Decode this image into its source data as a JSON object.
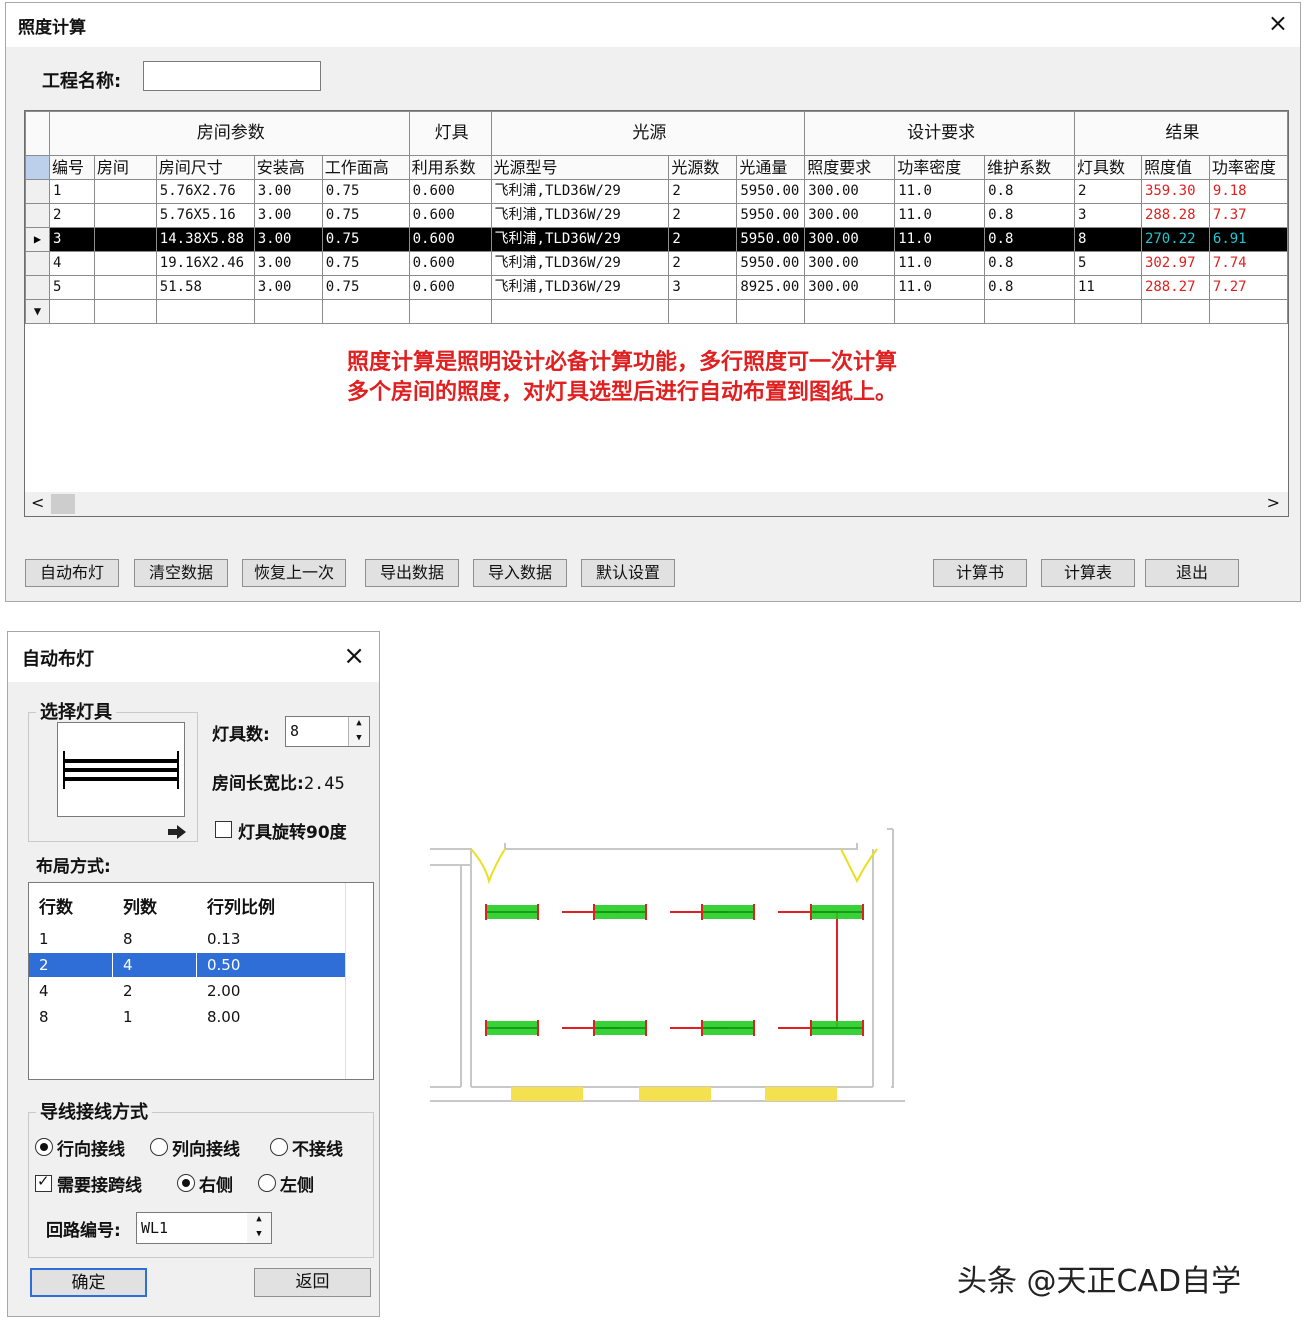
{
  "main_dialog": {
    "title": "照度计算",
    "close_icon": "×",
    "project_label": "工程名称:",
    "project_value": ""
  },
  "grid": {
    "groups": [
      "房间参数",
      "灯具",
      "光源",
      "设计要求",
      "结果"
    ],
    "columns": [
      "编号",
      "房间",
      "房间尺寸",
      "安装高",
      "工作面高",
      "利用系数",
      "光源型号",
      "光源数",
      "光通量",
      "照度要求",
      "功率密度",
      "维护系数",
      "灯具数",
      "照度值",
      "功率密度"
    ],
    "rows": [
      [
        "1",
        "",
        "5.76X2.76",
        "3.00",
        "0.75",
        "0.600",
        "飞利浦,TLD36W/29",
        "2",
        "5950.00",
        "300.00",
        "11.0",
        "0.8",
        "2",
        "359.30",
        "9.18"
      ],
      [
        "2",
        "",
        "5.76X5.16",
        "3.00",
        "0.75",
        "0.600",
        "飞利浦,TLD36W/29",
        "2",
        "5950.00",
        "300.00",
        "11.0",
        "0.8",
        "3",
        "288.28",
        "7.37"
      ],
      [
        "3",
        "",
        "14.38X5.88",
        "3.00",
        "0.75",
        "0.600",
        "飞利浦,TLD36W/29",
        "2",
        "5950.00",
        "300.00",
        "11.0",
        "0.8",
        "8",
        "270.22",
        "6.91"
      ],
      [
        "4",
        "",
        "19.16X2.46",
        "3.00",
        "0.75",
        "0.600",
        "飞利浦,TLD36W/29",
        "2",
        "5950.00",
        "300.00",
        "11.0",
        "0.8",
        "5",
        "302.97",
        "7.74"
      ],
      [
        "5",
        "",
        "51.58",
        "3.00",
        "0.75",
        "0.600",
        "飞利浦,TLD36W/29",
        "3",
        "8925.00",
        "300.00",
        "11.0",
        "0.8",
        "11",
        "288.27",
        "7.27"
      ]
    ],
    "selected_row": 3,
    "note_line1": "照度计算是照明设计必备计算功能，多行照度可一次计算",
    "note_line2": "多个房间的照度，对灯具选型后进行自动布置到图纸上。",
    "result_color": "#e02020",
    "selected_result_color": "#1ec8d0"
  },
  "buttons": {
    "auto_layout": "自动布灯",
    "clear_data": "清空数据",
    "undo_last": "恢复上一次",
    "export_data": "导出数据",
    "import_data": "导入数据",
    "default_settings": "默认设置",
    "calc_book": "计算书",
    "calc_table": "计算表",
    "exit": "退出"
  },
  "auto_dialog": {
    "title": "自动布灯",
    "close_icon": "×",
    "select_lamp_legend": "选择灯具",
    "lamp_count_label": "灯具数:",
    "lamp_count_value": "8",
    "ratio_label": "房间长宽比:",
    "ratio_value": "2.45",
    "rotate_label": "灯具旋转90度",
    "rotate_checked": false,
    "layout_label": "布局方式:",
    "layout_headers": [
      "行数",
      "列数",
      "行列比例"
    ],
    "layout_rows": [
      [
        "1",
        "8",
        "0.13"
      ],
      [
        "2",
        "4",
        "0.50"
      ],
      [
        "4",
        "2",
        "2.00"
      ],
      [
        "8",
        "1",
        "8.00"
      ]
    ],
    "layout_selected": 2,
    "wiring_legend": "导线接线方式",
    "wiring_options": [
      "行向接线",
      "列向接线",
      "不接线"
    ],
    "wiring_selected": "行向接线",
    "cross_label": "需要接跨线",
    "cross_checked": true,
    "side_options": [
      "右侧",
      "左侧"
    ],
    "side_selected": "右侧",
    "circuit_label": "回路编号:",
    "circuit_value": "WL1",
    "ok": "确定",
    "back": "返回"
  },
  "watermark": "头条 @天正CAD自学",
  "colors": {
    "lamp": "#22cc22",
    "wire": "#e02020",
    "window": "#f5e050",
    "door": "#e8e020",
    "selection": "#2f6ed6"
  }
}
